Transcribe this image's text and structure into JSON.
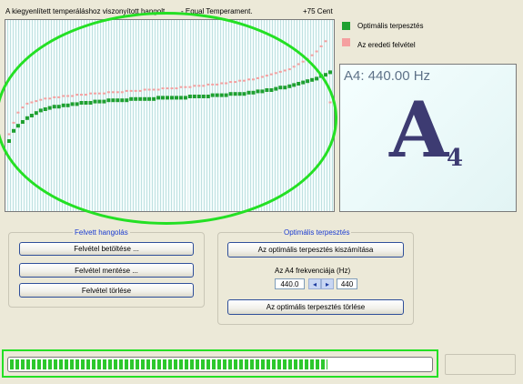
{
  "chart_title": "A kiegyenlített temperáláshoz viszonyított hangolt.......   - Equal Temperament.",
  "chart_scale": "+75 Cent",
  "legend": {
    "optimal": {
      "label": "Optimális terpesztés",
      "color": "#1ea030"
    },
    "recorded": {
      "label": "Az eredeti felvétel",
      "color": "#f5a0a0"
    }
  },
  "note_display": {
    "frequency": "A4: 440.00 Hz",
    "letter": "A",
    "octave": "4"
  },
  "recorded_group": {
    "title": "Felvett hangolás",
    "load_label": "Felvétel betöltése ...",
    "save_label": "Felvétel mentése ...",
    "delete_label": "Felvétel törlése"
  },
  "optimal_group": {
    "title": "Optimális terpesztés",
    "calc_label": "Az optimális terpesztés kiszámítása",
    "a4_label": "Az A4 frekvenciája (Hz)",
    "a4_value": "440.0",
    "a4_value2": "440",
    "delete_label": "Az optimális terpesztés törlése"
  },
  "progress": {
    "fraction": 0.755
  },
  "chart_data": {
    "type": "scatter",
    "title": "A kiegyenlített temperáláshoz viszonyított hangolt.......   - Equal Temperament.",
    "ylabel": "+75 Cent",
    "ylim": [
      -75,
      75
    ],
    "x": [
      1,
      2,
      3,
      4,
      5,
      6,
      7,
      8,
      9,
      10,
      11,
      12,
      13,
      14,
      15,
      16,
      17,
      18,
      19,
      20,
      21,
      22,
      23,
      24,
      25,
      26,
      27,
      28,
      29,
      30,
      31,
      32,
      33,
      34,
      35,
      36,
      37,
      38,
      39,
      40,
      41,
      42,
      43,
      44,
      45,
      46,
      47,
      48,
      49,
      50,
      51,
      52,
      53,
      54,
      55,
      56,
      57,
      58,
      59,
      60,
      61,
      62,
      63,
      64,
      65,
      66,
      67,
      68,
      69,
      70,
      71,
      72
    ],
    "series": [
      {
        "name": "Optimális terpesztés",
        "color": "#1ea030",
        "values": [
          -20,
          -12,
          -8,
          -5,
          -2,
          0,
          2,
          4,
          5,
          6,
          7,
          7,
          8,
          8,
          9,
          9,
          10,
          10,
          10,
          11,
          11,
          11,
          12,
          12,
          12,
          12,
          12,
          13,
          13,
          13,
          13,
          13,
          13,
          14,
          14,
          14,
          14,
          14,
          14,
          14,
          15,
          15,
          15,
          15,
          15,
          16,
          16,
          16,
          16,
          17,
          17,
          17,
          17,
          18,
          18,
          19,
          19,
          20,
          20,
          21,
          22,
          22,
          23,
          24,
          25,
          26,
          27,
          28,
          29,
          31,
          32,
          34
        ]
      },
      {
        "name": "Az eredeti felvétel",
        "color": "#f5a0a0",
        "values": [
          -15,
          -6,
          2,
          6,
          9,
          10,
          11,
          12,
          13,
          13,
          14,
          14,
          15,
          15,
          15,
          16,
          16,
          16,
          17,
          17,
          17,
          17,
          18,
          18,
          18,
          18,
          19,
          19,
          19,
          19,
          20,
          20,
          20,
          20,
          21,
          21,
          21,
          21,
          22,
          22,
          22,
          23,
          23,
          23,
          24,
          24,
          24,
          25,
          25,
          26,
          26,
          27,
          27,
          28,
          28,
          29,
          30,
          31,
          32,
          33,
          34,
          35,
          36,
          38,
          40,
          42,
          44,
          47,
          50,
          54,
          58,
          10
        ]
      }
    ]
  }
}
